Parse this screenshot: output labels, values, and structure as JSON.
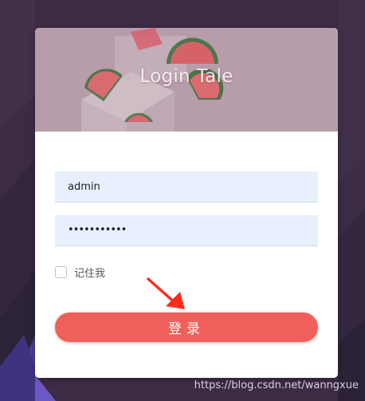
{
  "banner": {
    "title": "Login Tale"
  },
  "form": {
    "username_value": "admin",
    "password_masked": "•••••••••••",
    "remember_label": "记住我",
    "remember_checked": false,
    "login_label": "登录"
  },
  "watermark": "https://blog.csdn.net/wanngxue",
  "colors": {
    "page_background": "#3c2b45",
    "banner_tint": "#b79ca9",
    "field_background": "#e8f0fe",
    "button_accent": "#f0605a",
    "annotation_arrow": "#ff2a1a"
  },
  "icons": {
    "annotation": "red-arrow-icon",
    "banner_art": "watermelon-illustration"
  }
}
